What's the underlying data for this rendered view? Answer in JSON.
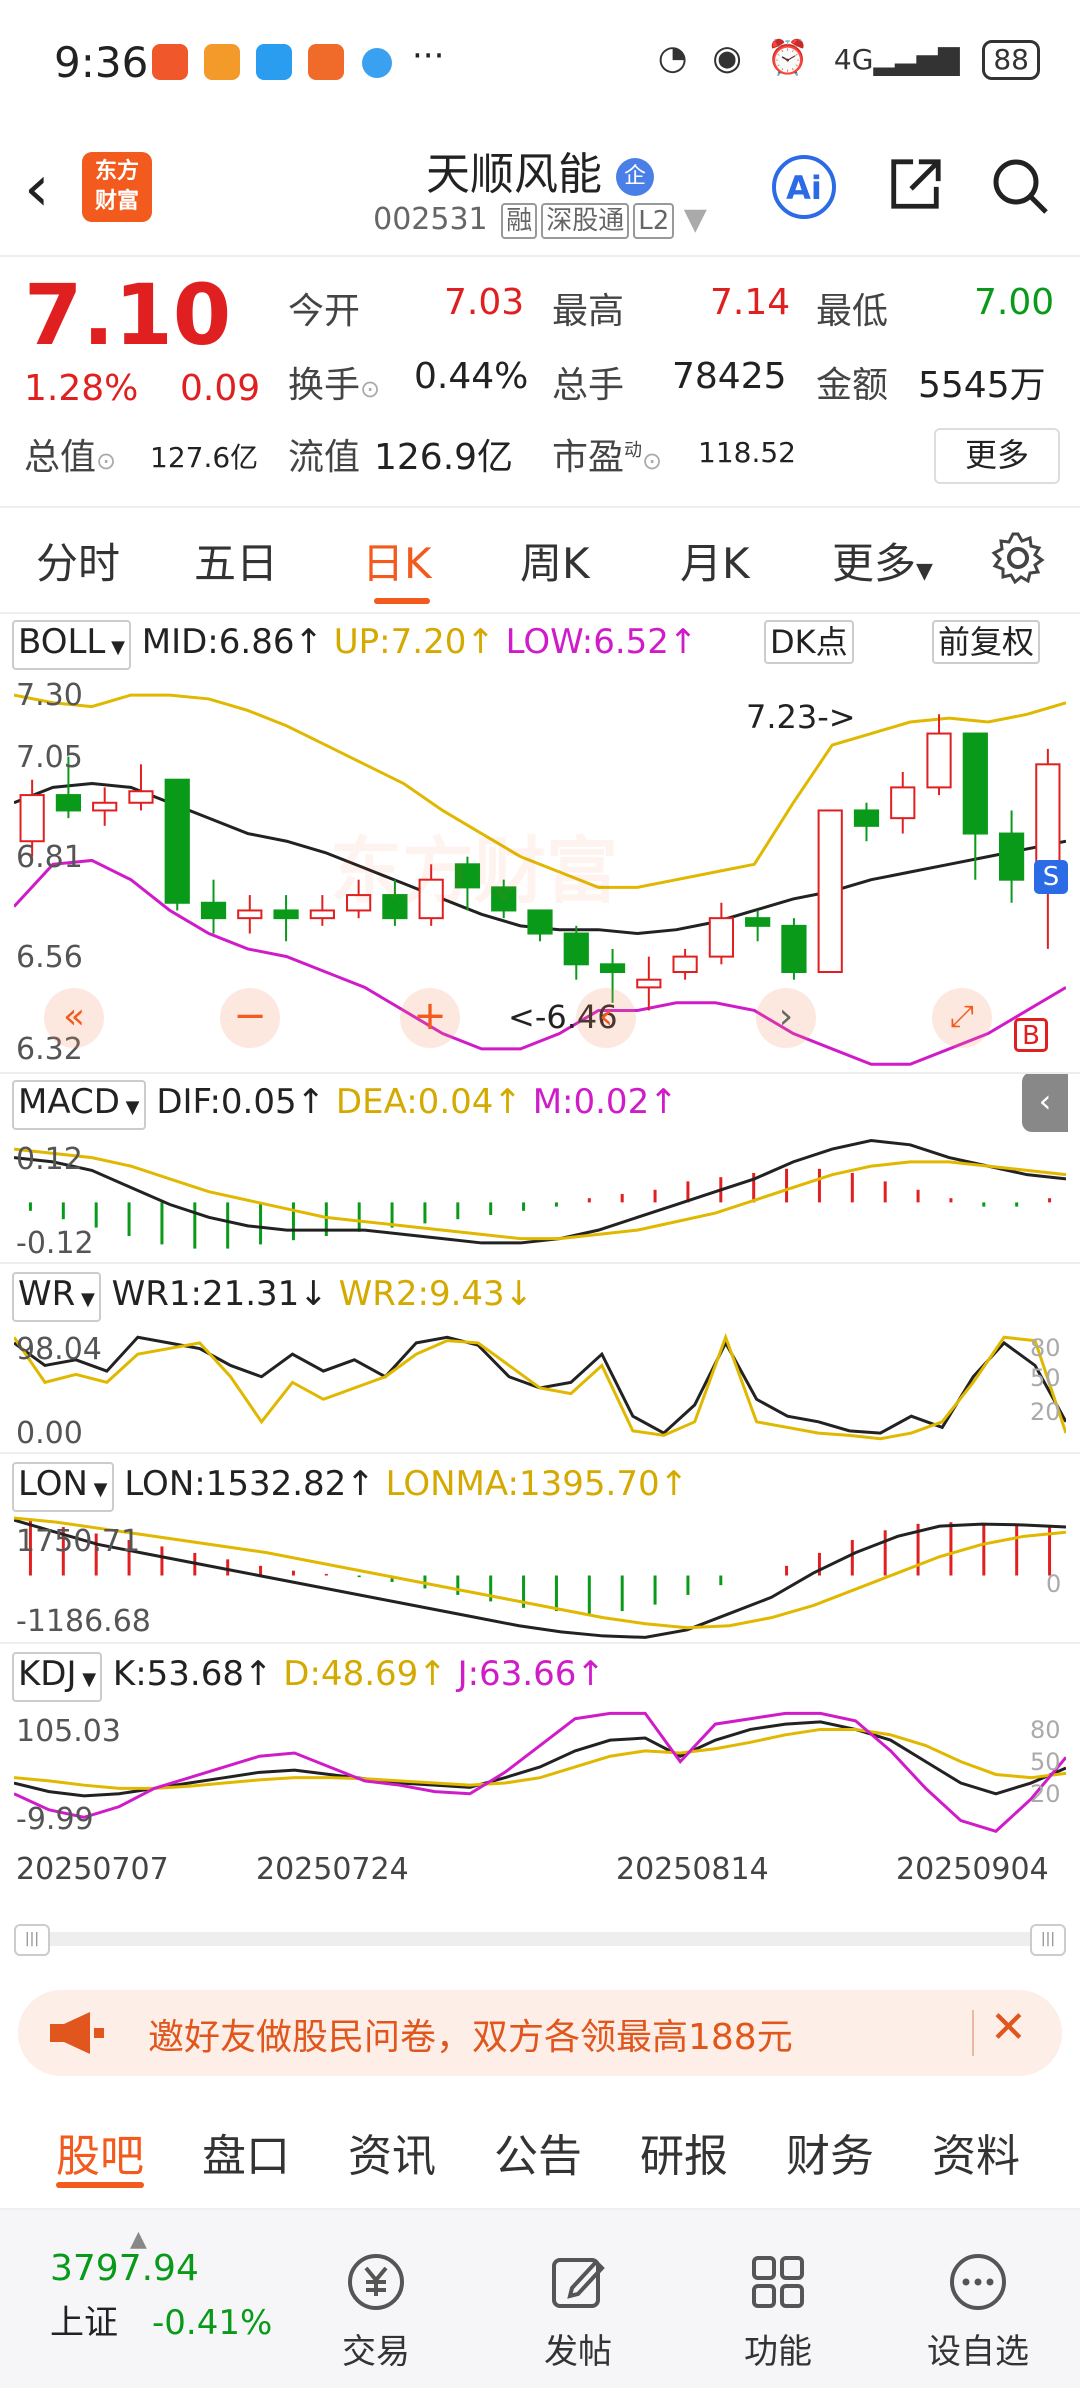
{
  "status_bar": {
    "time": "9:36",
    "battery": "88"
  },
  "header": {
    "back_icon": "chevron-left-icon",
    "logo_line1": "东方",
    "logo_line2": "财富",
    "stock_name": "天顺风能",
    "badge": "企",
    "code": "002531",
    "tags": [
      "融",
      "深股通",
      "L2"
    ],
    "ai_label": "Ai"
  },
  "quote": {
    "price": "7.10",
    "change_pct": "1.28%",
    "change": "0.09",
    "open_label": "今开",
    "open": "7.03",
    "high_label": "最高",
    "high": "7.14",
    "low_label": "最低",
    "low": "7.00",
    "turnover_label": "换手",
    "turnover": "0.44%",
    "volume_label": "总手",
    "volume": "78425",
    "amount_label": "金额",
    "amount": "5545万",
    "mcap_label": "总值",
    "mcap": "127.6亿",
    "float_label": "流值",
    "float": "126.9亿",
    "pe_label": "市盈",
    "pe_sup": "动",
    "pe": "118.52",
    "more": "更多"
  },
  "tabs": [
    "分时",
    "五日",
    "日K",
    "周K",
    "月K",
    "更多"
  ],
  "active_tab": 2,
  "kline": {
    "indicator": "BOLL",
    "mid": "MID:6.86↑",
    "up": "UP:7.20↑",
    "low": "LOW:6.52↑",
    "dk": "DK点",
    "adjust": "前复权",
    "y_labels": [
      "7.30",
      "7.05",
      "6.81",
      "6.56",
      "6.32"
    ],
    "max_note": "7.23->",
    "min_note": "<-6.46",
    "s_badge": "S",
    "b_badge": "B",
    "watermark": "东方财富"
  },
  "macd": {
    "name": "MACD",
    "dif": "DIF:0.05↑",
    "dea": "DEA:0.04↑",
    "m": "M:0.02↑",
    "y_top": "0.12",
    "y_bot": "-0.12"
  },
  "wr": {
    "name": "WR",
    "wr1": "WR1:21.31↓",
    "wr2": "WR2:9.43↓",
    "y_top": "98.04",
    "y_bot": "0.00",
    "r1": "80",
    "r2": "50",
    "r3": "20"
  },
  "lon": {
    "name": "LON",
    "lon": "LON:1532.82↑",
    "lonma": "LONMA:1395.70↑",
    "y_top": "1750.71",
    "y_bot": "-1186.68",
    "r": "0"
  },
  "kdj": {
    "name": "KDJ",
    "k": "K:53.68↑",
    "d": "D:48.69↑",
    "j": "J:63.66↑",
    "y_top": "105.03",
    "y_bot": "-9.99",
    "r1": "80",
    "r2": "50",
    "r3": "20"
  },
  "dates": [
    "20250707",
    "20250724",
    "20250814",
    "20250904"
  ],
  "promo": {
    "text": "邀好友做股民问卷，双方各领最高188元"
  },
  "bottom_tabs": [
    "股吧",
    "盘口",
    "资讯",
    "公告",
    "研报",
    "财务",
    "资料"
  ],
  "footer": {
    "index_value": "3797.94",
    "index_name": "上证",
    "index_change": "-0.41%",
    "items": [
      "交易",
      "发帖",
      "功能",
      "设自选"
    ]
  },
  "colors": {
    "up": "#e02020",
    "down": "#0a9a1a",
    "accent": "#f25a1e",
    "yellow": "#e0b800",
    "magenta": "#d01cc8"
  }
}
